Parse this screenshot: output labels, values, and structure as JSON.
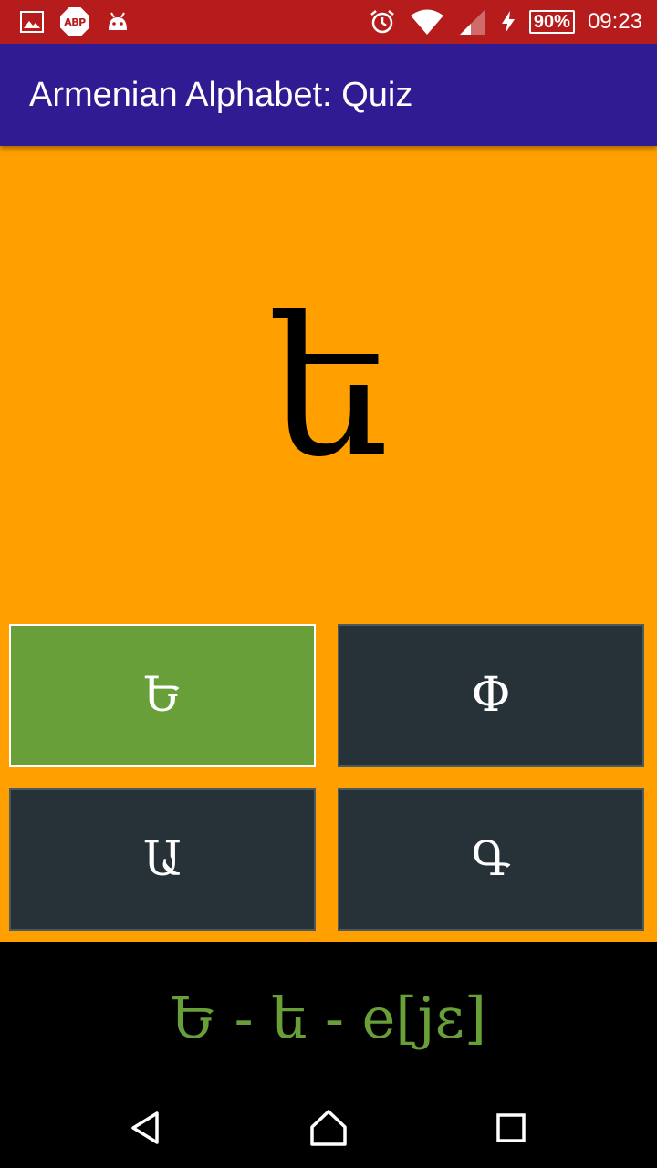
{
  "status_bar": {
    "left_icons": [
      "image-icon",
      "adblock-icon",
      "android-icon"
    ],
    "abp_label": "ABP",
    "right_icons": [
      "alarm-icon",
      "wifi-icon",
      "signal-icon",
      "charging-icon"
    ],
    "battery": "90%",
    "time": "09:23"
  },
  "app_bar": {
    "title": "Armenian Alphabet: Quiz"
  },
  "quiz": {
    "question_letter": "ե",
    "answers": [
      {
        "label": "Ե",
        "state": "correct"
      },
      {
        "label": "Փ",
        "state": "normal"
      },
      {
        "label": "Ա",
        "state": "normal"
      },
      {
        "label": "Գ",
        "state": "normal"
      }
    ]
  },
  "result": {
    "text": "Ե - ե - e[jɛ]"
  },
  "nav_bar": {
    "icons": [
      "back-icon",
      "home-icon",
      "recents-icon"
    ]
  },
  "colors": {
    "status_bar": "#b71c1c",
    "app_bar": "#311b92",
    "main_background": "#ffa000",
    "answer_default": "#263238",
    "answer_correct": "#689f38",
    "result_text": "#689f38"
  }
}
